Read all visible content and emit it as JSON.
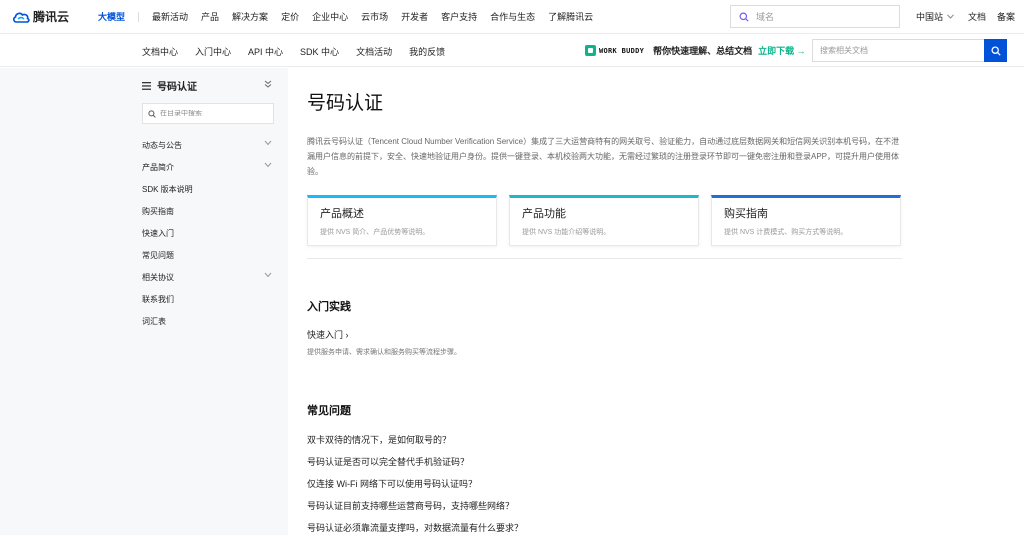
{
  "topnav": {
    "logo_text": "腾讯云",
    "items": [
      "大模型",
      "最新活动",
      "产品",
      "解决方案",
      "定价",
      "企业中心",
      "云市场",
      "开发者",
      "客户支持",
      "合作与生态",
      "了解腾讯云"
    ],
    "search_placeholder": "域名",
    "region": "中国站",
    "docs": "文档",
    "filing": "备案"
  },
  "subnav": {
    "items": [
      "文档中心",
      "入门中心",
      "API 中心",
      "SDK 中心",
      "文档活动",
      "我的反馈"
    ],
    "promo_brand": "WORK BUDDY",
    "promo_text": "帮你快速理解、总结文档",
    "promo_cta": "立即下载 →",
    "search_placeholder": "搜索相关文档"
  },
  "sidebar": {
    "title": "号码认证",
    "search_placeholder": "在目录中搜索",
    "items": [
      {
        "label": "动态与公告",
        "expandable": true
      },
      {
        "label": "产品简介",
        "expandable": true
      },
      {
        "label": "SDK 版本说明",
        "expandable": false
      },
      {
        "label": "购买指南",
        "expandable": false
      },
      {
        "label": "快速入门",
        "expandable": false
      },
      {
        "label": "常见问题",
        "expandable": false
      },
      {
        "label": "相关协议",
        "expandable": true
      },
      {
        "label": "联系我们",
        "expandable": false
      },
      {
        "label": "词汇表",
        "expandable": false
      }
    ]
  },
  "main": {
    "title": "号码认证",
    "intro": "腾讯云号码认证（Tencent Cloud Number Verification Service）集成了三大运营商特有的网关取号、验证能力，自动通过底层数据网关和短信网关识别本机号码，在不泄漏用户信息的前提下，安全、快速地验证用户身份。提供一键登录、本机校验两大功能，无需经过繁琐的注册登录环节即可一键免密注册和登录APP，可提升用户使用体验。",
    "cards": [
      {
        "title": "产品概述",
        "desc": "提供 NVS 简介、产品优势等说明。"
      },
      {
        "title": "产品功能",
        "desc": "提供 NVS 功能介绍等说明。"
      },
      {
        "title": "购买指南",
        "desc": "提供 NVS 计费模式、购买方式等说明。"
      }
    ],
    "practice_title": "入门实践",
    "quickstart_label": "快速入门 ›",
    "quickstart_desc": "提供服务申请、需求确认和服务购买等流程步骤。",
    "faq_title": "常见问题",
    "faqs": [
      "双卡双待的情况下，是如何取号的？",
      "号码认证是否可以完全替代手机验证码？",
      "仅连接 Wi-Fi 网络下可以使用号码认证吗？",
      "号码认证目前支持哪些运营商号码，支持哪些网络？",
      "号码认证必须靠流量支撑吗，对数据流量有什么要求？"
    ]
  },
  "colors": {
    "brand_blue": "#0052d9",
    "promo_green": "#0ab58b",
    "card_top_1": "#1cb9f5",
    "card_top_2": "#1cb9c8",
    "card_top_3": "#1f6fd6"
  }
}
